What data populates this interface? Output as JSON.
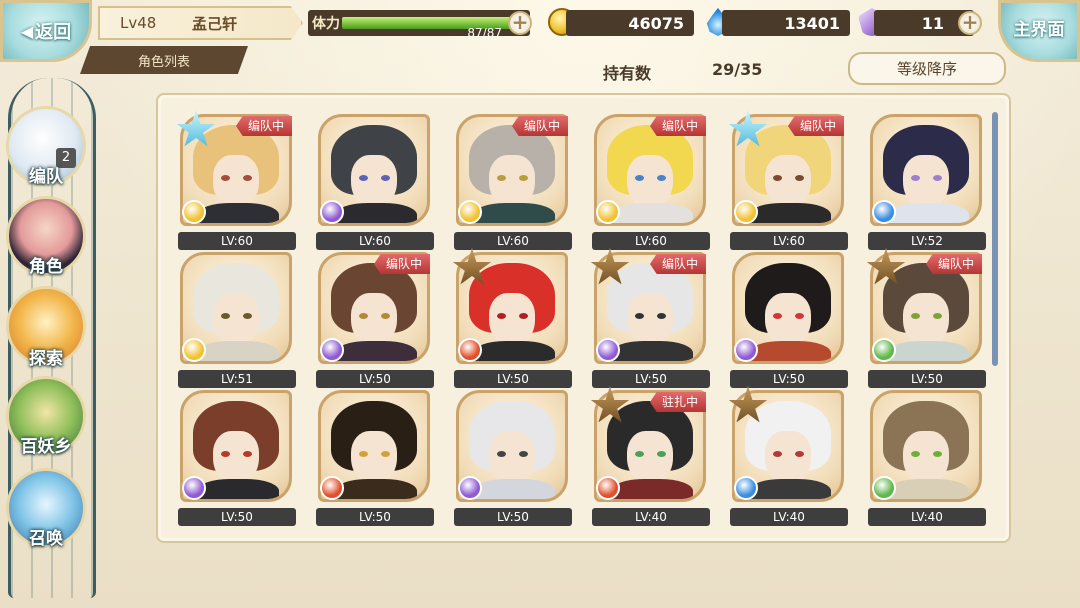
{
  "header": {
    "back_label": "返回",
    "level": "Lv48",
    "player_name": "孟己轩",
    "tab_label": "角色列表",
    "stamina_label": "体力",
    "stamina_value": "87/87",
    "stamina_fraction": 1.0,
    "coins": "46075",
    "soul_fire": "13401",
    "crystals": "11",
    "home_label": "主界面"
  },
  "toolbar": {
    "owned_label": "持有数",
    "owned_count": "29/35",
    "sort_label": "等级降序"
  },
  "sidebar": {
    "items": [
      {
        "label": "编队",
        "badge": "2"
      },
      {
        "label": "角色"
      },
      {
        "label": "探索"
      },
      {
        "label": "百妖乡"
      },
      {
        "label": "召唤"
      }
    ]
  },
  "characters": [
    {
      "level": "LV:60",
      "tag": "编队中",
      "star": "blue",
      "element": "gold",
      "hair": "#e8c27a",
      "outfit": "#2e2e35",
      "eye": "#a54f3a"
    },
    {
      "level": "LV:60",
      "tag": "",
      "star": "",
      "element": "purple",
      "hair": "#3f4246",
      "outfit": "#2a2a2f",
      "eye": "#5c63b5"
    },
    {
      "level": "LV:60",
      "tag": "编队中",
      "star": "",
      "element": "gold",
      "hair": "#b8b1a9",
      "outfit": "#2f4b4a",
      "eye": "#b79d3c"
    },
    {
      "level": "LV:60",
      "tag": "编队中",
      "star": "",
      "element": "gold",
      "hair": "#f2d84e",
      "outfit": "#e3e0de",
      "eye": "#4a82c9"
    },
    {
      "level": "LV:60",
      "tag": "编队中",
      "star": "blue",
      "element": "gold",
      "hair": "#f1d57a",
      "outfit": "#2a2a2a",
      "eye": "#7c4a2c"
    },
    {
      "level": "LV:52",
      "tag": "",
      "star": "",
      "element": "blue",
      "hair": "#2d2b4a",
      "outfit": "#dfe4ec",
      "eye": "#9f7dd1"
    },
    {
      "level": "LV:51",
      "tag": "",
      "star": "",
      "element": "gold",
      "hair": "#e9e6de",
      "outfit": "#d8d3c4",
      "eye": "#6b5a2a"
    },
    {
      "level": "LV:50",
      "tag": "编队中",
      "star": "",
      "element": "purple",
      "hair": "#6a4632",
      "outfit": "#3e2e3b",
      "eye": "#b08a3a"
    },
    {
      "level": "LV:50",
      "tag": "",
      "star": "brown",
      "element": "red",
      "hair": "#d9302a",
      "outfit": "#2b2b2b",
      "eye": "#b02020"
    },
    {
      "level": "LV:50",
      "tag": "编队中",
      "star": "brown",
      "element": "purple",
      "hair": "#e6e6e6",
      "outfit": "#333333",
      "eye": "#333333"
    },
    {
      "level": "LV:50",
      "tag": "",
      "star": "",
      "element": "purple",
      "hair": "#1f1b1b",
      "outfit": "#b64a2e",
      "eye": "#d23535"
    },
    {
      "level": "LV:50",
      "tag": "编队中",
      "star": "brown",
      "element": "green",
      "hair": "#5b4a3b",
      "outfit": "#cbd5cf",
      "eye": "#7fa23a"
    },
    {
      "level": "LV:50",
      "tag": "",
      "star": "",
      "element": "purple",
      "hair": "#7a3e2a",
      "outfit": "#2a2a2e",
      "eye": "#b83a2a"
    },
    {
      "level": "LV:50",
      "tag": "",
      "star": "",
      "element": "red",
      "hair": "#2a1f14",
      "outfit": "#3a2b1d",
      "eye": "#d2a23a"
    },
    {
      "level": "LV:50",
      "tag": "",
      "star": "",
      "element": "purple",
      "hair": "#e7e7ea",
      "outfit": "#d3d6dc",
      "eye": "#444444"
    },
    {
      "level": "LV:40",
      "tag": "驻扎中",
      "star": "brown",
      "element": "red",
      "hair": "#2a2a2a",
      "outfit": "#7a2a28",
      "eye": "#4aa05a"
    },
    {
      "level": "LV:40",
      "tag": "",
      "star": "brown",
      "element": "blue",
      "hair": "#f1f1f1",
      "outfit": "#3a3a3a",
      "eye": "#b33a3a"
    },
    {
      "level": "LV:40",
      "tag": "",
      "star": "",
      "element": "green",
      "hair": "#8a7455",
      "outfit": "#d9cfb6",
      "eye": "#6fae3a"
    }
  ],
  "colors": {
    "tag_red": "#c84646",
    "lv_bar": "#3e3e3e",
    "stamina_green": "#77c13b",
    "accent_teal": "#a8dcde",
    "element_gold": "#f2c230",
    "element_purple": "#8f5ad3",
    "element_red": "#e0502a",
    "element_blue": "#3a8de0",
    "element_green": "#5fb84a"
  }
}
